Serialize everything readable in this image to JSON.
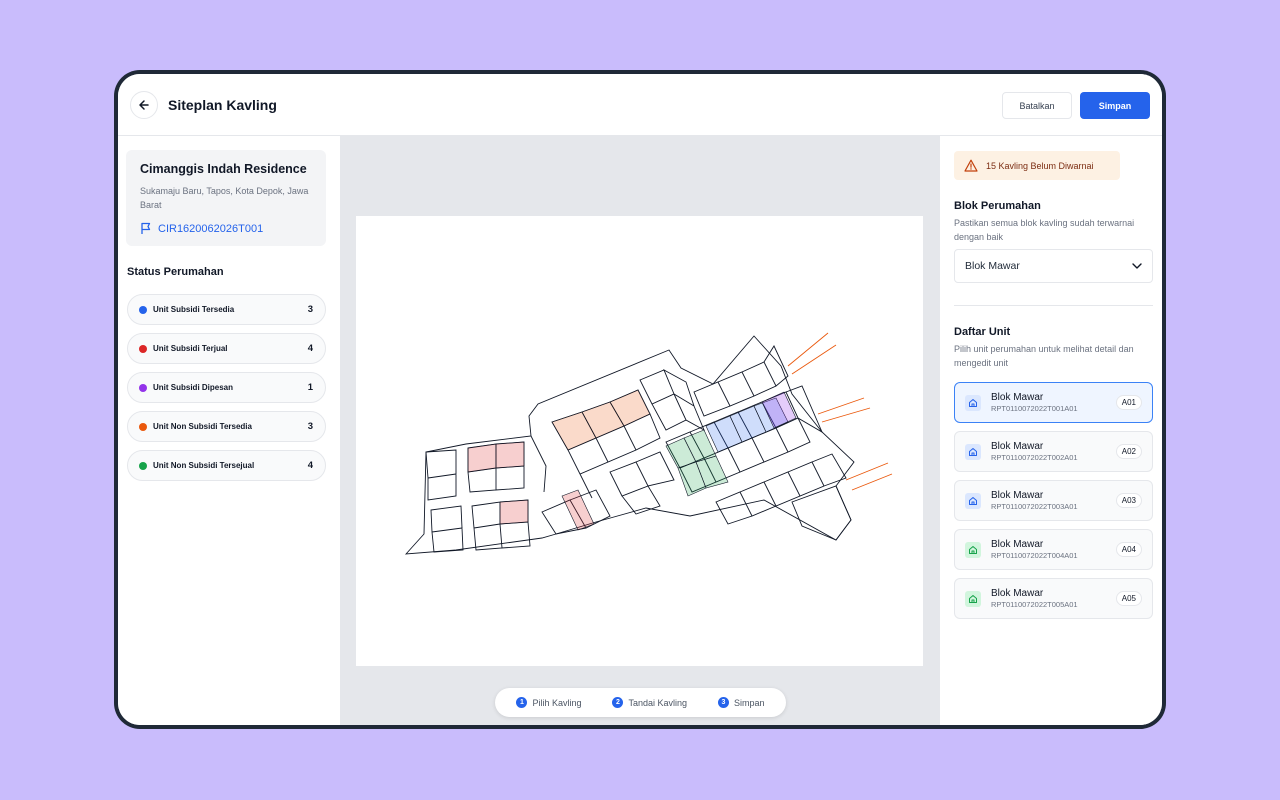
{
  "header": {
    "title": "Siteplan Kavling",
    "cancel_label": "Batalkan",
    "save_label": "Simpan"
  },
  "project": {
    "name": "Cimanggis Indah Residence",
    "address": "Sukamaju Baru, Tapos, Kota Depok, Jawa Barat",
    "code": "CIR1620062026T001"
  },
  "status": {
    "title": "Status Perumahan",
    "items": [
      {
        "label": "Unit Subsidi Tersedia",
        "count": "3",
        "color": "#2563eb"
      },
      {
        "label": "Unit Subsidi Terjual",
        "count": "4",
        "color": "#dc2626"
      },
      {
        "label": "Unit Subsidi Dipesan",
        "count": "1",
        "color": "#9333ea"
      },
      {
        "label": "Unit Non Subsidi Tersedia",
        "count": "3",
        "color": "#ea580c"
      },
      {
        "label": "Unit Non Subsidi Tersejual",
        "count": "4",
        "color": "#16a34a"
      }
    ]
  },
  "stepper": {
    "steps": [
      {
        "num": "1",
        "label": "Pilih Kavling"
      },
      {
        "num": "2",
        "label": "Tandai Kavling"
      },
      {
        "num": "3",
        "label": "Simpan"
      }
    ]
  },
  "right": {
    "warning": "15 Kavling Belum Diwarnai",
    "blok_title": "Blok Perumahan",
    "blok_sub": "Pastikan semua blok kavling sudah terwarnai dengan baik",
    "blok_selected": "Blok Mawar",
    "units_title": "Daftar Unit",
    "units_sub": "Pilih unit perumahan untuk melihat detail dan mengedit unit",
    "units": [
      {
        "name": "Blok Mawar",
        "code": "RPT0110072022T001A01",
        "badge": "A01",
        "color": "#2563eb",
        "icon_bg": "#dbe7fe"
      },
      {
        "name": "Blok Mawar",
        "code": "RPT0110072022T002A01",
        "badge": "A02",
        "color": "#2563eb",
        "icon_bg": "#dbe7fe"
      },
      {
        "name": "Blok Mawar",
        "code": "RPT0110072022T003A01",
        "badge": "A03",
        "color": "#2563eb",
        "icon_bg": "#dbe7fe"
      },
      {
        "name": "Blok Mawar",
        "code": "RPT0110072022T004A01",
        "badge": "A04",
        "color": "#16a34a",
        "icon_bg": "#d1f5dd"
      },
      {
        "name": "Blok Mawar",
        "code": "RPT0110072022T005A01",
        "badge": "A05",
        "color": "#16a34a",
        "icon_bg": "#d1f5dd"
      }
    ]
  },
  "colors": {
    "accent": "#2563eb",
    "sold": "#dc2626",
    "reserved": "#9333ea",
    "nonsubsidi": "#ea580c",
    "nonsubsidi_sold": "#16a34a"
  }
}
